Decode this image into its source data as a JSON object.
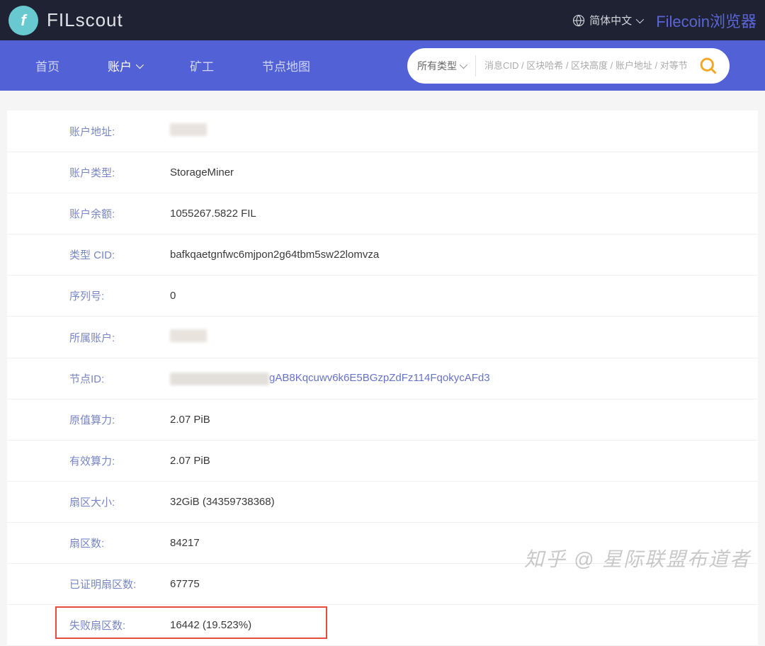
{
  "header": {
    "logo_letter": "f",
    "logo_text": "FILscout",
    "language_label": "简体中文",
    "brand_label": "Filecoin浏览器"
  },
  "nav": {
    "items": [
      {
        "label": "首页",
        "active": false,
        "has_dropdown": false
      },
      {
        "label": "账户",
        "active": true,
        "has_dropdown": true
      },
      {
        "label": "矿工",
        "active": false,
        "has_dropdown": false
      },
      {
        "label": "节点地图",
        "active": false,
        "has_dropdown": false
      }
    ],
    "search": {
      "type_label": "所有类型",
      "placeholder": "消息CID / 区块哈希 / 区块高度 / 账户地址 / 对等节点标"
    }
  },
  "details": {
    "rows": [
      {
        "label": "账户地址:",
        "value": "",
        "redacted": "short"
      },
      {
        "label": "账户类型:",
        "value": "StorageMiner"
      },
      {
        "label": "账户余额:",
        "value": "1055267.5822 FIL"
      },
      {
        "label": "类型 CID:",
        "value": "bafkqaetgnfwc6mjpon2g64tbm5sw22lomvza"
      },
      {
        "label": "序列号:",
        "value": "0"
      },
      {
        "label": "所属账户:",
        "value": "",
        "redacted": "short"
      },
      {
        "label": "节点ID:",
        "value": "gAB8Kqcuwv6k6E5BGzpZdFz114FqokycAFd3",
        "redacted": "long-prefix",
        "link": true
      },
      {
        "label": "原值算力:",
        "value": "2.07 PiB"
      },
      {
        "label": "有效算力:",
        "value": "2.07 PiB"
      },
      {
        "label": "扇区大小:",
        "value": "32GiB (34359738368)"
      },
      {
        "label": "扇区数:",
        "value": "84217"
      },
      {
        "label": "已证明扇区数:",
        "value": "67775"
      },
      {
        "label": "失败扇区数:",
        "value": "16442 (19.523%)",
        "highlighted": true
      }
    ]
  },
  "watermark": "知乎 @ 星际联盟布道者"
}
